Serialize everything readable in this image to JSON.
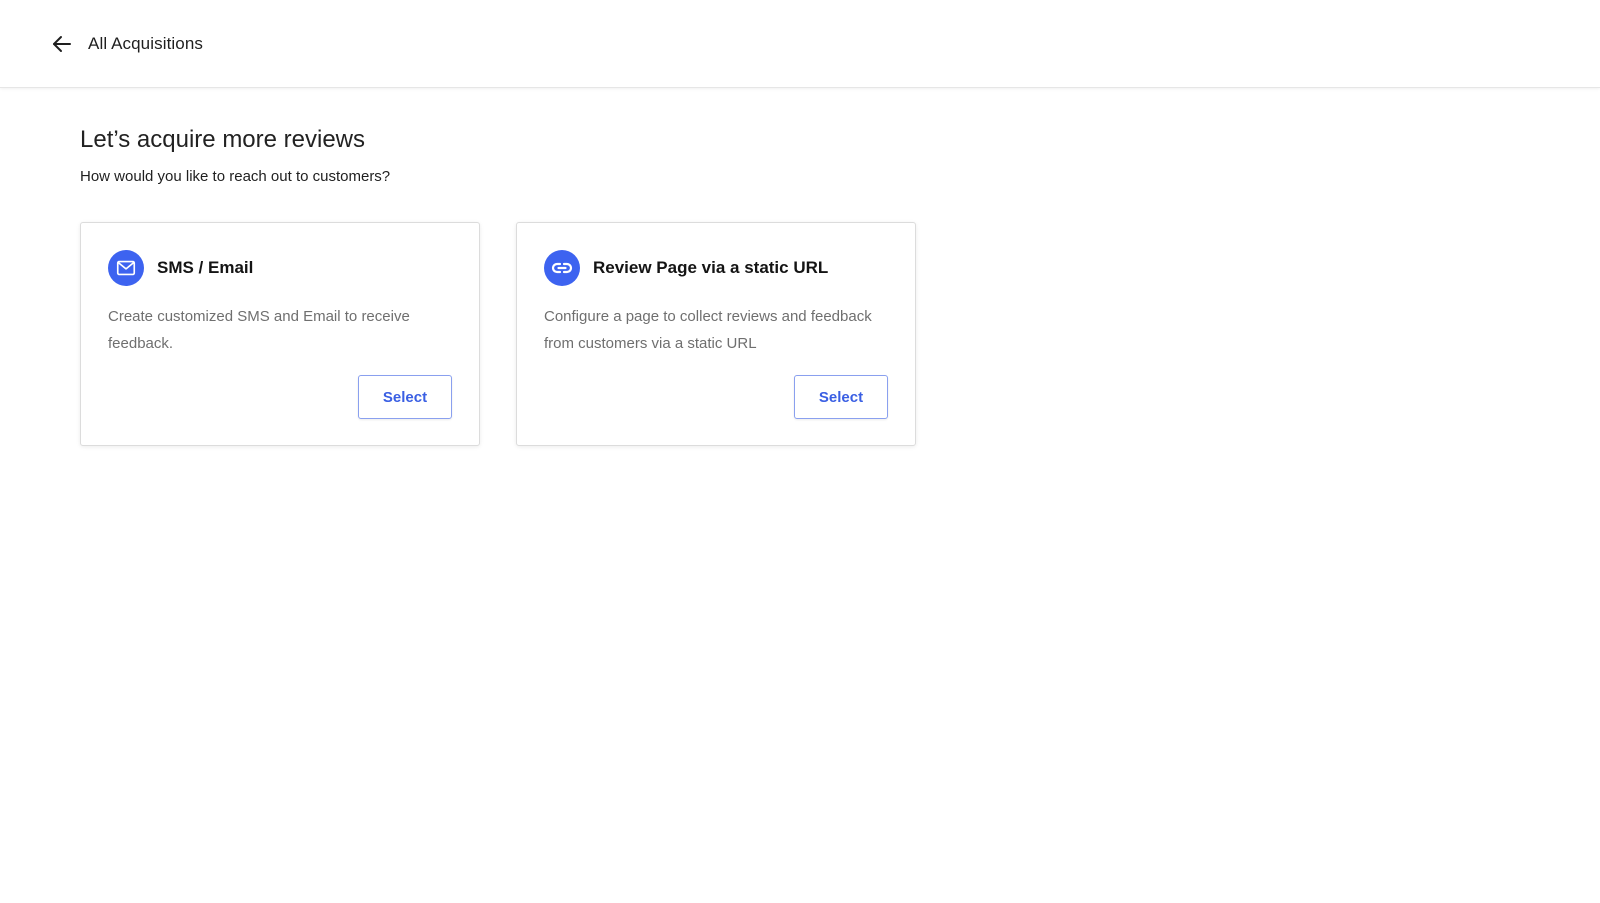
{
  "header": {
    "back_label": "All Acquisitions",
    "back_icon": "arrow-left-icon"
  },
  "main": {
    "title": "Let’s acquire more reviews",
    "subtitle": "How would you like to reach out to customers?",
    "options": [
      {
        "icon": "mail-icon",
        "title": "SMS / Email",
        "description": "Create customized SMS and Email to receive feedback.",
        "button_label": "Select"
      },
      {
        "icon": "link-icon",
        "title": "Review Page via a static URL",
        "description": "Configure a page to collect reviews and feedback from customers via a static URL",
        "button_label": "Select"
      }
    ]
  },
  "colors": {
    "accent": "#3d63f0",
    "button_text": "#3a5fe3",
    "button_border": "#8aa0ef"
  }
}
